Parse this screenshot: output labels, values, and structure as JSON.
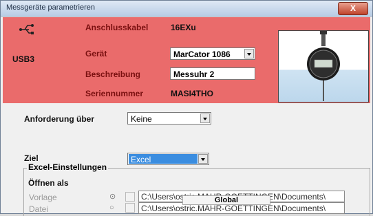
{
  "window": {
    "title": "Messgeräte parametrieren",
    "close_glyph": "X"
  },
  "header": {
    "usb_label": "USB3",
    "rows": [
      {
        "label": "Anschlusskabel",
        "value": "16EXu"
      },
      {
        "label": "Gerät",
        "value": "MarCator 1086"
      },
      {
        "label": "Beschreibung",
        "value": "Messuhr 2"
      },
      {
        "label": "Seriennummer",
        "value": "MASI4THO"
      }
    ],
    "accent": "#ea6b6b"
  },
  "request": {
    "label": "Anforderung über",
    "value": "Keine"
  },
  "target": {
    "label": "Ziel",
    "value": "Excel"
  },
  "excel": {
    "group_title": "Excel-Einstellungen",
    "open_as": "Öffnen als",
    "options": [
      {
        "label": "Vorlage",
        "radio": "⊙",
        "path": "C:\\Users\\ostric.MAHR-GOETTINGEN\\Documents\\"
      },
      {
        "label": "Datei",
        "radio": "○",
        "path": "C:\\Users\\ostric.MAHR-GOETTINGEN\\Documents\\"
      }
    ],
    "tooltip": "Global"
  }
}
